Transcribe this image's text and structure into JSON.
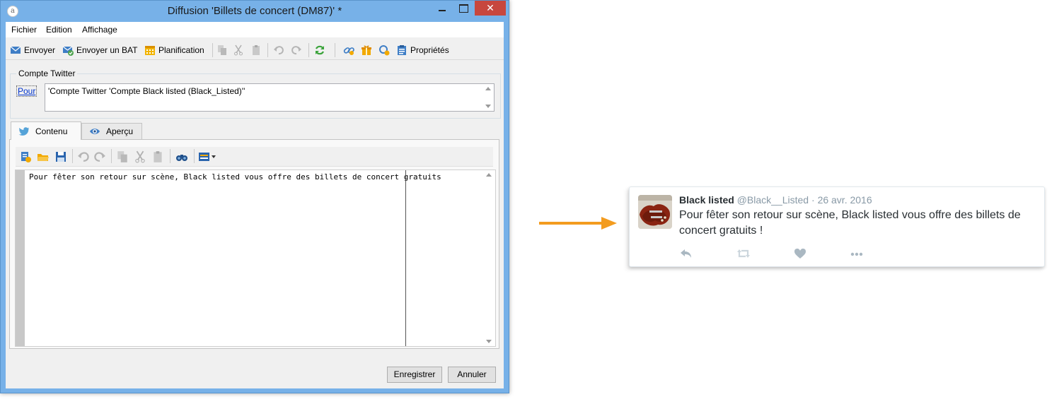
{
  "window": {
    "title": "Diffusion 'Billets de concert (DM87)' *",
    "close_glyph": "✕"
  },
  "menu": [
    "Fichier",
    "Edition",
    "Affichage"
  ],
  "toolbar": {
    "send": "Envoyer",
    "send_proof": "Envoyer un BAT",
    "schedule": "Planification",
    "properties": "Propriétés"
  },
  "recipient": {
    "group_label": "Compte Twitter",
    "to_link": "Pour",
    "to_value": "'Compte Twitter 'Compte Black listed (Black_Listed)''"
  },
  "tabs": [
    {
      "label": "Contenu",
      "icon": "twitter-bird-icon"
    },
    {
      "label": "Aperçu",
      "icon": "eye-icon"
    }
  ],
  "editor": {
    "content": "Pour fêter son retour sur scène, Black listed vous offre des billets de concert gratuits"
  },
  "buttons": {
    "save": "Enregistrer",
    "cancel": "Annuler"
  },
  "tweet": {
    "name": "Black listed",
    "handle": "@Black__Listed",
    "separator": "·",
    "date": "26 avr. 2016",
    "text": "Pour fêter son retour sur scène, Black listed vous offre des billets de concert gratuits !",
    "actions": [
      "reply-icon",
      "retweet-icon",
      "like-icon",
      "more-icon"
    ]
  },
  "colors": {
    "window_frame": "#77b1e8",
    "close_button": "#c7473e",
    "arrow": "#f39c1f",
    "twitter_blue": "#1da1f2",
    "tweet_gray": "#8899a6"
  }
}
